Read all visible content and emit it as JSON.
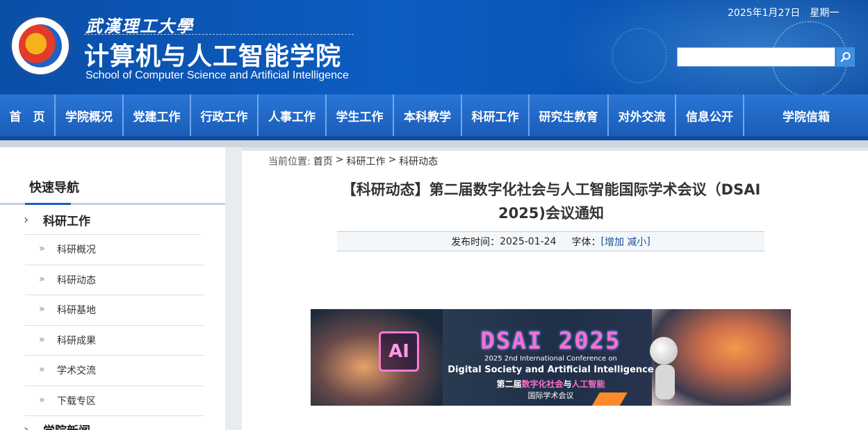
{
  "header": {
    "university_cn": "武漢理工大學",
    "college_cn": "计算机与人工智能学院",
    "college_en": "School of Computer Science and Artificial Intelligence",
    "date": "2025年1月27日　星期一",
    "search": {
      "value": "",
      "placeholder": ""
    }
  },
  "nav": {
    "items": [
      {
        "label": "首　页",
        "w": 80
      },
      {
        "label": "学院概况",
        "w": 98
      },
      {
        "label": "党建工作",
        "w": 97
      },
      {
        "label": "行政工作",
        "w": 97
      },
      {
        "label": "人事工作",
        "w": 98
      },
      {
        "label": "学生工作",
        "w": 97
      },
      {
        "label": "本科教学",
        "w": 98
      },
      {
        "label": "科研工作",
        "w": 97
      },
      {
        "label": "研究生教育",
        "w": 114
      },
      {
        "label": "对外交流",
        "w": 97
      },
      {
        "label": "信息公开",
        "w": 98
      },
      {
        "label": "学院信箱",
        "w": 178
      }
    ]
  },
  "sidebar": {
    "title": "快速导航",
    "section": "科研工作",
    "items": [
      "科研概况",
      "科研动态",
      "科研基地",
      "科研成果",
      "学术交流",
      "下载专区"
    ],
    "next_section": "学院新闻"
  },
  "breadcrumb": {
    "label": "当前位置:",
    "items": [
      "首页",
      "科研工作",
      "科研动态"
    ],
    "sep": ">"
  },
  "article": {
    "title_line1": "【科研动态】第二届数字化社会与人工智能国际学术会议（DSAI",
    "title_line2": "2025)会议通知",
    "publish_label": "发布时间：",
    "publish_date": "2025-01-24",
    "font_label": "字体：",
    "font_open": "[",
    "font_increase": "增加",
    "font_decrease": "减小",
    "font_close": "]"
  },
  "banner": {
    "chip": "AI",
    "title": "DSAI 2025",
    "line1": "2025 2nd International Conference on",
    "line2": "Digital Society and Artificial Intelligence",
    "line3_a": "第二届",
    "line3_b": "数字化社会",
    "line3_c": "与",
    "line3_d": "人工智能",
    "line4": "国际学术会议"
  }
}
